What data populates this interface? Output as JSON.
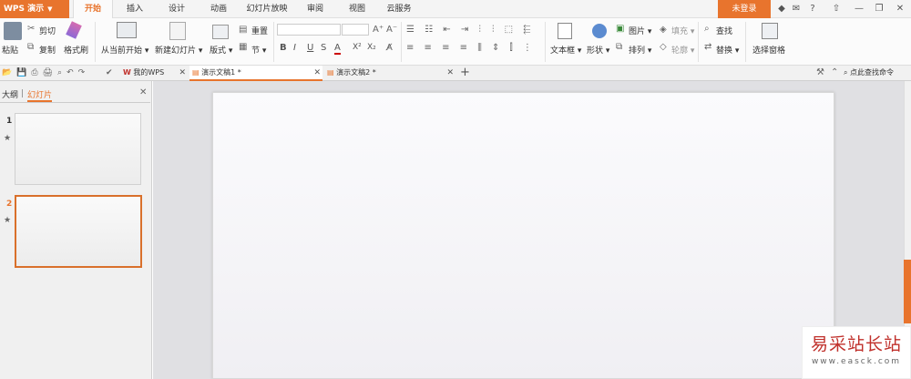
{
  "app": {
    "name": "WPS 演示",
    "accent": "#e8742d"
  },
  "menu": {
    "tabs": [
      "开始",
      "插入",
      "设计",
      "动画",
      "幻灯片放映",
      "审阅",
      "视图",
      "云服务"
    ],
    "active": "开始",
    "login": "未登录"
  },
  "ribbon": {
    "paste": "粘贴",
    "cut": "剪切",
    "copy": "复制",
    "format_painter": "格式刷",
    "from_current": "从当前开始",
    "new_slide": "新建幻灯片",
    "layout": "版式",
    "reset": "重置",
    "section": "节",
    "bold": "B",
    "italic": "I",
    "underline": "U",
    "strike": "S",
    "font_color": "A",
    "superscript": "X²",
    "subscript": "X₂",
    "text_box": "文本框",
    "shape": "形状",
    "picture": "图片",
    "arrange": "排列",
    "fill": "填充",
    "outline": "轮廓",
    "find": "查找",
    "replace": "替换",
    "selection_pane": "选择窗格"
  },
  "doc_tabs": [
    {
      "label": "我的WPS"
    },
    {
      "label": "演示文稿1 *"
    },
    {
      "label": "演示文稿2 *"
    }
  ],
  "search_cmd": "点此查找命令",
  "left_pane": {
    "tabs": [
      "大纲",
      "幻灯片"
    ],
    "active": "幻灯片",
    "slides": [
      {
        "num": "1"
      },
      {
        "num": "2"
      }
    ]
  },
  "watermark": {
    "title": "易采站长站",
    "url": "www.easck.com"
  }
}
